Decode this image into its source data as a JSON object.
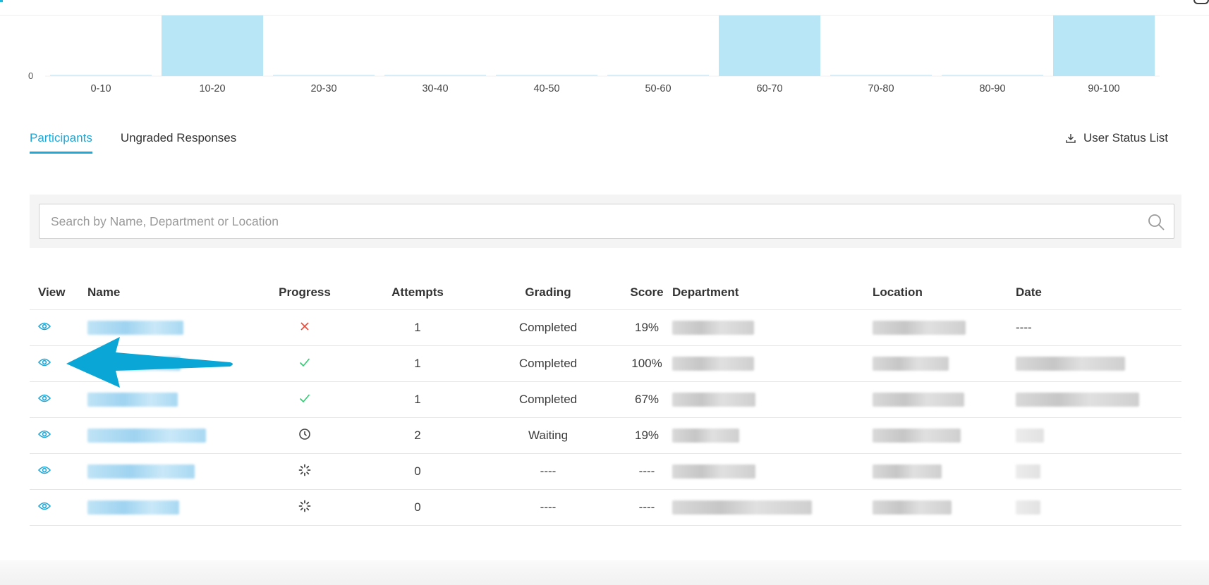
{
  "chart_data": {
    "type": "bar",
    "categories": [
      "0-10",
      "10-20",
      "20-30",
      "30-40",
      "40-50",
      "50-60",
      "60-70",
      "70-80",
      "80-90",
      "90-100"
    ],
    "values": [
      0,
      1,
      0,
      0,
      0,
      0,
      1,
      0,
      0,
      1
    ],
    "y_tick_labels": [
      "0"
    ],
    "bar_color": "#b9e6f7",
    "zero_line_color": "#d7eef8",
    "grid": false
  },
  "tabs": [
    {
      "label": "Participants",
      "active": true
    },
    {
      "label": "Ungraded Responses",
      "active": false
    }
  ],
  "user_status_label": "User Status List",
  "search": {
    "placeholder": "Search by Name, Department or Location",
    "value": ""
  },
  "table": {
    "headers": {
      "view": "View",
      "name": "Name",
      "progress": "Progress",
      "attempts": "Attempts",
      "grading": "Grading",
      "score": "Score",
      "department": "Department",
      "location": "Location",
      "date": "Date"
    },
    "rows": [
      {
        "progress_icon": "x-icon",
        "attempts": "1",
        "grading": "Completed",
        "score": "19%",
        "date": "----"
      },
      {
        "progress_icon": "check-icon",
        "attempts": "1",
        "grading": "Completed",
        "score": "100%",
        "date": ""
      },
      {
        "progress_icon": "check-icon",
        "attempts": "1",
        "grading": "Completed",
        "score": "67%",
        "date": ""
      },
      {
        "progress_icon": "clock-icon",
        "attempts": "2",
        "grading": "Waiting",
        "score": "19%",
        "date": ""
      },
      {
        "progress_icon": "spinner-icon",
        "attempts": "0",
        "grading": "----",
        "score": "----",
        "date": ""
      },
      {
        "progress_icon": "spinner-icon",
        "attempts": "0",
        "grading": "----",
        "score": "----",
        "date": ""
      }
    ]
  },
  "colors": {
    "accent": "#1fa7d6",
    "arrow": "#0aa6d6",
    "error": "#e74c3c",
    "success": "#2ecc71"
  }
}
